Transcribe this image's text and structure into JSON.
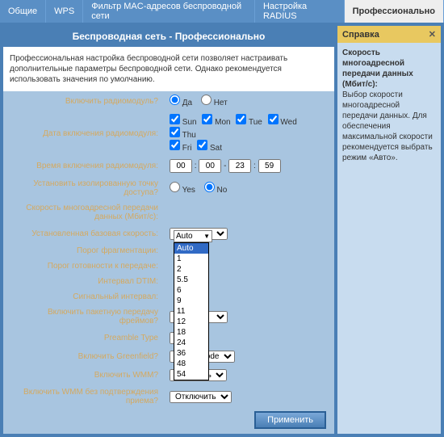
{
  "tabs": {
    "t0": "Общие",
    "t1": "WPS",
    "t2": "Фильтр MAC-адресов беспроводной сети",
    "t3": "Настройка RADIUS",
    "t4": "Профессионально"
  },
  "main": {
    "header": "Беспроводная сеть - Профессионально",
    "desc": "Профессиональная настройка беспроводной сети позволяет настраивать дополнительные параметры беспроводной сети. Однако рекомендуется использовать значения по умолчанию."
  },
  "labels": {
    "radio": "Включить радиомодуль?",
    "date": "Дата включения радиомодуля:",
    "time": "Время включения радиомодуля:",
    "ap": "Установить изолированную точку доступа?",
    "mrate": "Скорость многоадресной передачи данных (Мбит/с):",
    "brate": "Установленная базовая скорость:",
    "frag": "Порог фрагментации:",
    "rts": "Порог готовности к передаче:",
    "dtim": "Интервал DTIM:",
    "beacon": "Сигнальный интервал:",
    "burst": "Включить пакетную передачу фреймов?",
    "preamble": "Preamble Type",
    "green": "Включить Greenfield?",
    "wmm": "Включить WMM?",
    "wmm_noack": "Включить WMM без подтверждения приема?"
  },
  "radio": {
    "opt_yes": "Да",
    "opt_no": "Нет"
  },
  "days": {
    "sun": "Sun",
    "mon": "Mon",
    "tue": "Tue",
    "wed": "Wed",
    "thu": "Thu",
    "fri": "Fri",
    "sat": "Sat"
  },
  "time": {
    "h1": "00",
    "m1": "00",
    "h2": "23",
    "m2": "59",
    "sep1": ":",
    "sep2": "-",
    "sep3": ":"
  },
  "ap": {
    "yes": "Yes",
    "no": "No"
  },
  "mrate": {
    "selected": "Auto",
    "options": [
      "Auto",
      "1",
      "2",
      "5.5",
      "6",
      "9",
      "11",
      "12",
      "18",
      "24",
      "36",
      "48",
      "54"
    ]
  },
  "preamble": {
    "value": "Long"
  },
  "green": {
    "value": "Mixed Mode"
  },
  "wmm": {
    "value": "Включить"
  },
  "wmm_noack": {
    "value": "Отключить"
  },
  "apply": "Применить",
  "help": {
    "title": "Справка",
    "heading": "Скорость многоадресной передачи данных (Мбит/с):",
    "body": "Выбор скорости многоадресной передачи данных. Для обеспечения максимальной скорости рекомендуется выбрать режим «Авто»."
  },
  "chart_data": null
}
